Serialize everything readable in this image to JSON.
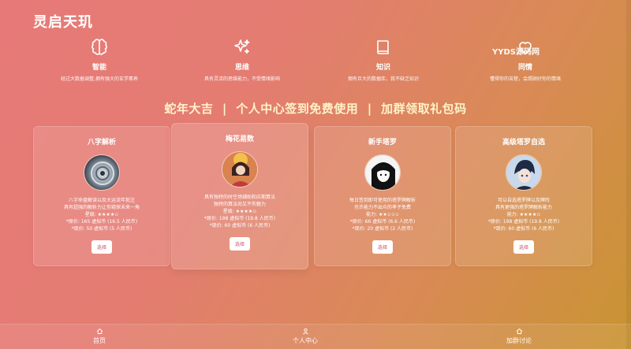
{
  "app": {
    "title": "灵启天玑"
  },
  "features": [
    {
      "icon": "brain-icon",
      "title": "智能",
      "desc": "经过大数据调整,拥有强大的玄学素养"
    },
    {
      "icon": "sparkle-icon",
      "title": "思维",
      "desc": "具有灵活的思维能力，不受情绪影响"
    },
    {
      "icon": "book-icon",
      "title": "知识",
      "desc": "拥有巨大的数据库，我不缺乏知识"
    },
    {
      "icon": "heart-icon",
      "title": "同情",
      "desc": "懂得你的苦楚，会照顾好你的情绪"
    }
  ],
  "watermark": "YYDS源码网",
  "banner": "蛇年大吉  |  个人中心签到免费使用  |  加群领取礼包码",
  "cards": [
    {
      "title": "八字解析",
      "desc": [
        "八字命盘解读以及大运流年批注",
        "具有超强的解析力让你窥探未来一角",
        "星级: ★★★★✩"
      ],
      "price": [
        "*原价: 165 虚拟币 (16.5 人民币)",
        "*现价: 50 虚拟币 (5 人民币)"
      ],
      "button": "选择"
    },
    {
      "title": "梅花易数",
      "desc": [
        "具有独特的时空场辅助和应期算法",
        "独特的算法尚又不失魅力",
        "星级: ★★★★✩"
      ],
      "price": [
        "*原价: 198 虚拟币 (19.8 人民币)",
        "*现价: 60 虚拟币 (6 人民币)"
      ],
      "button": "选择"
    },
    {
      "title": "新手塔罗",
      "desc": [
        "每日签到即可使用的塔罗牌解析",
        "也许能力不出众的孝子免费",
        "能力: ★★✩✩✩"
      ],
      "price": [
        "*原价: 66 虚拟币 (6.6 人民币)",
        "*现价: 20 虚拟币 (2 人民币)"
      ],
      "button": "选择"
    },
    {
      "title": "高级塔罗自选",
      "desc": [
        "可以自选塔罗牌以及牌阵",
        "具有更强的塔罗牌解析能力",
        "能力: ★★★★✩"
      ],
      "price": [
        "*原价: 198 虚拟币 (19.8 人民币)",
        "*现价: 60 虚拟币 (6 人民币)"
      ],
      "button": "选择"
    }
  ],
  "nav": [
    {
      "icon": "home-icon",
      "label": "首页"
    },
    {
      "icon": "user-icon",
      "label": "个人中心"
    },
    {
      "icon": "group-icon",
      "label": "加群讨论"
    }
  ]
}
